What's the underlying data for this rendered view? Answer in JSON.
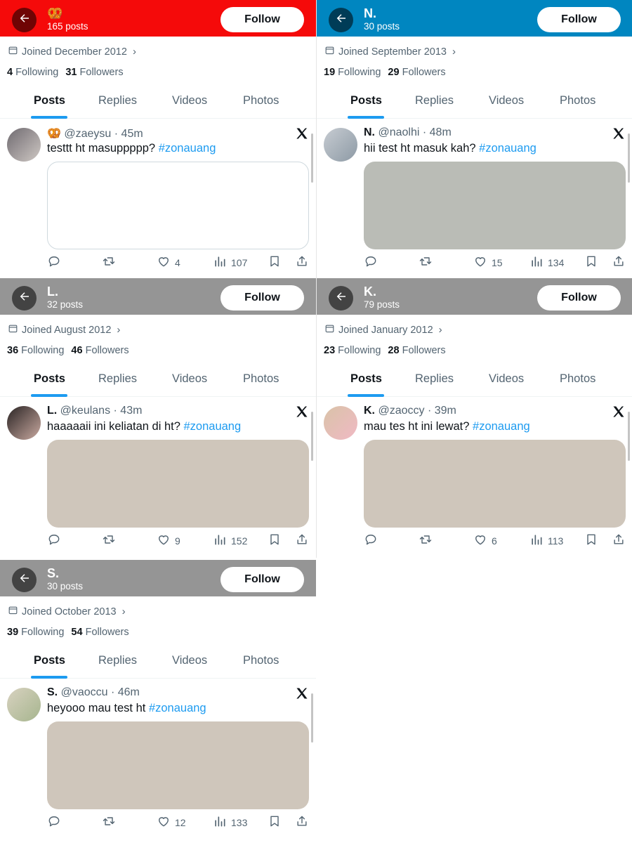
{
  "common": {
    "follow_label": "Follow",
    "tabs": [
      "Posts",
      "Replies",
      "Videos",
      "Photos"
    ],
    "following_word": "Following",
    "followers_word": "Followers",
    "hashtag": "#zonauang",
    "dot": "·"
  },
  "panels": [
    {
      "header_color": "#f50a0a",
      "name": "🥨",
      "posts": "165 posts",
      "joined": "Joined December 2012",
      "following": "4",
      "followers": "31",
      "tweet": {
        "name": "🥨",
        "handle": "@zaeysu",
        "time": "45m",
        "text": "testtt ht masuppppp?",
        "media": "blank",
        "media_color": "#ffffff",
        "replies": "",
        "retweets": "",
        "likes": "4",
        "views": "107"
      },
      "avatar_colors": [
        "#6f6a70",
        "#cfc8c4"
      ]
    },
    {
      "header_color": "#0086c0",
      "name": "N.",
      "posts": "30 posts",
      "joined": "Joined September 2013",
      "following": "19",
      "followers": "29",
      "tweet": {
        "name": "N.",
        "handle": "@naolhi",
        "time": "48m",
        "text": "hii test ht masuk kah?",
        "media": "filled",
        "media_color": "#babcb6",
        "likes": "15",
        "views": "134"
      },
      "avatar_colors": [
        "#c7ccd2",
        "#8d9aa5"
      ]
    },
    {
      "header_color": "#959595",
      "name": "L.",
      "posts": "32 posts",
      "joined": "Joined August 2012",
      "following": "36",
      "followers": "46",
      "tweet": {
        "name": "L.",
        "handle": "@keulans",
        "time": "43m",
        "text": "haaaaaii ini keliatan di ht?",
        "media": "filled",
        "media_color": "#cfc6bb",
        "likes": "9",
        "views": "152"
      },
      "avatar_colors": [
        "#2a2424",
        "#c9a9a0"
      ]
    },
    {
      "header_color": "#959595",
      "name": "K.",
      "posts": "79 posts",
      "joined": "Joined January 2012",
      "following": "23",
      "followers": "28",
      "tweet": {
        "name": "K.",
        "handle": "@zaoccy",
        "time": "39m",
        "text": "mau tes ht ini lewat?",
        "media": "filled",
        "media_color": "#cfc6bb",
        "likes": "6",
        "views": "113"
      },
      "avatar_colors": [
        "#d9c3a8",
        "#f0b9c4"
      ]
    },
    {
      "header_color": "#959595",
      "name": "S.",
      "posts": "30 posts",
      "joined": "Joined October 2013",
      "following": "39",
      "followers": "54",
      "tweet": {
        "name": "S.",
        "handle": "@vaoccu",
        "time": "46m",
        "text": "heyooo mau test ht",
        "media": "filled",
        "media_color": "#cfc6bb",
        "likes": "12",
        "views": "133"
      },
      "avatar_colors": [
        "#d8d2c0",
        "#a6b58e"
      ]
    }
  ]
}
